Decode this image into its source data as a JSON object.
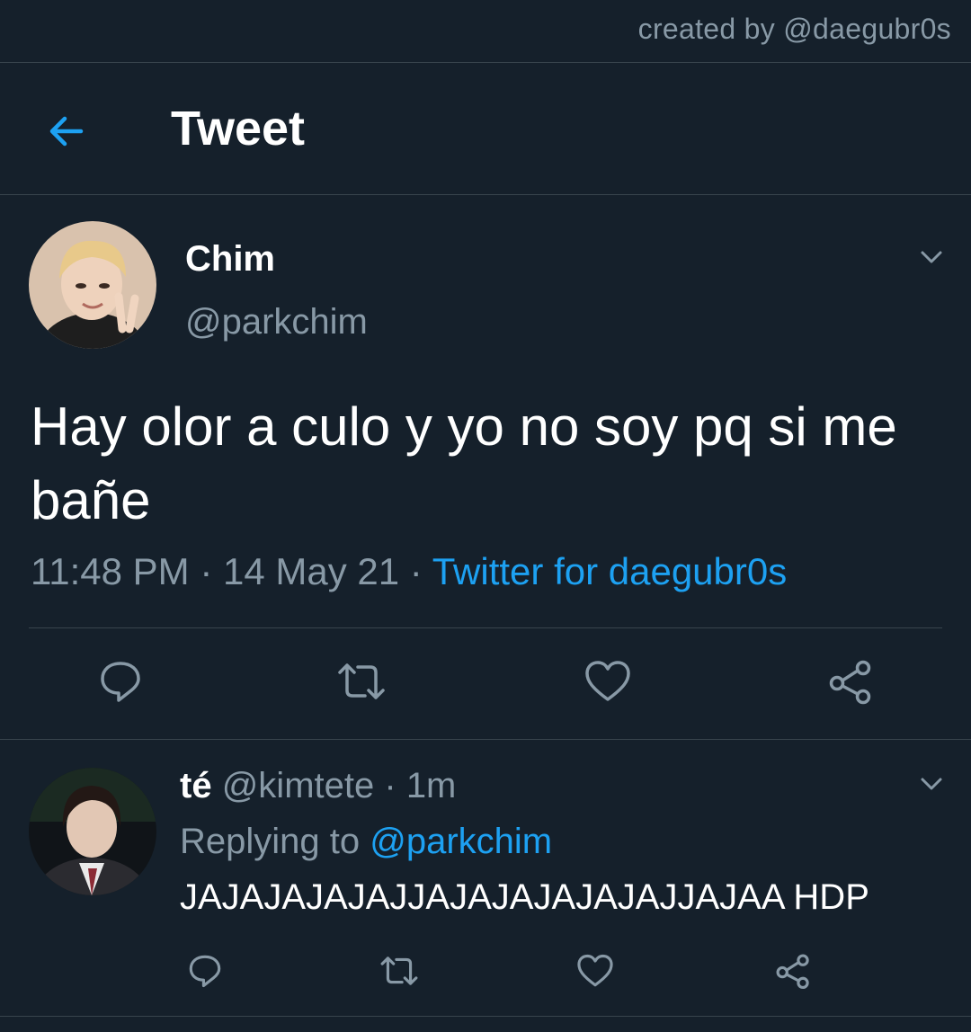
{
  "credit": "created by @daegubr0s",
  "header": {
    "title": "Tweet",
    "back_icon": "arrow-left-icon"
  },
  "tweet": {
    "name": "Chim",
    "handle": "@parkchim",
    "text": "Hay olor a culo y yo no soy pq si me bañe",
    "time": "11:48 PM",
    "sep": "·",
    "date": "14 May 21",
    "source": "Twitter for daegubr0s",
    "actions": [
      "reply-icon",
      "retweet-icon",
      "like-icon",
      "share-icon"
    ]
  },
  "reply": {
    "name": "té",
    "handle": "@kimtete",
    "sep": "·",
    "age": "1m",
    "replying_label": "Replying to",
    "replying_handle": "@parkchim",
    "text": "JAJAJAJAJAJJAJAJAJAJAJAJJAJAA HDP",
    "actions": [
      "reply-icon",
      "retweet-icon",
      "like-icon",
      "share-icon"
    ]
  },
  "colors": {
    "background": "#15202b",
    "accent": "#1da1f2",
    "muted": "#8899a6",
    "divider": "#38444d"
  }
}
